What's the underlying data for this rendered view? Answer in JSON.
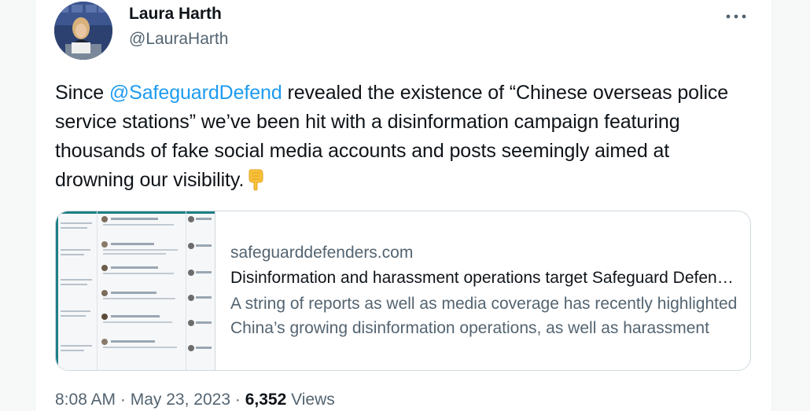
{
  "author": {
    "name": "Laura Harth",
    "handle": "@LauraHarth"
  },
  "tweet": {
    "text_before": "Since ",
    "mention": "@SafeguardDefend",
    "text_after": " revealed the existence of “Chinese overseas police service stations” we’ve been hit with a disinformation campaign featuring thousands of fake social media accounts and posts seemingly aimed at drowning our visibility.",
    "emoji": "backhand-index-pointing-down"
  },
  "card": {
    "domain": "safeguarddefenders.com",
    "title": "Disinformation and harassment operations target Safeguard Defenders",
    "description": "A string of reports as well as media coverage has recently highlighted China’s growing disinformation operations, as well as harassment"
  },
  "meta": {
    "time": "8:08 AM",
    "separator": "·",
    "date": "May 23, 2023",
    "views_count": "6,352",
    "views_label": "Views"
  },
  "colors": {
    "link": "#1d9bf0",
    "secondary_text": "#536471",
    "border": "#cfd9de"
  }
}
